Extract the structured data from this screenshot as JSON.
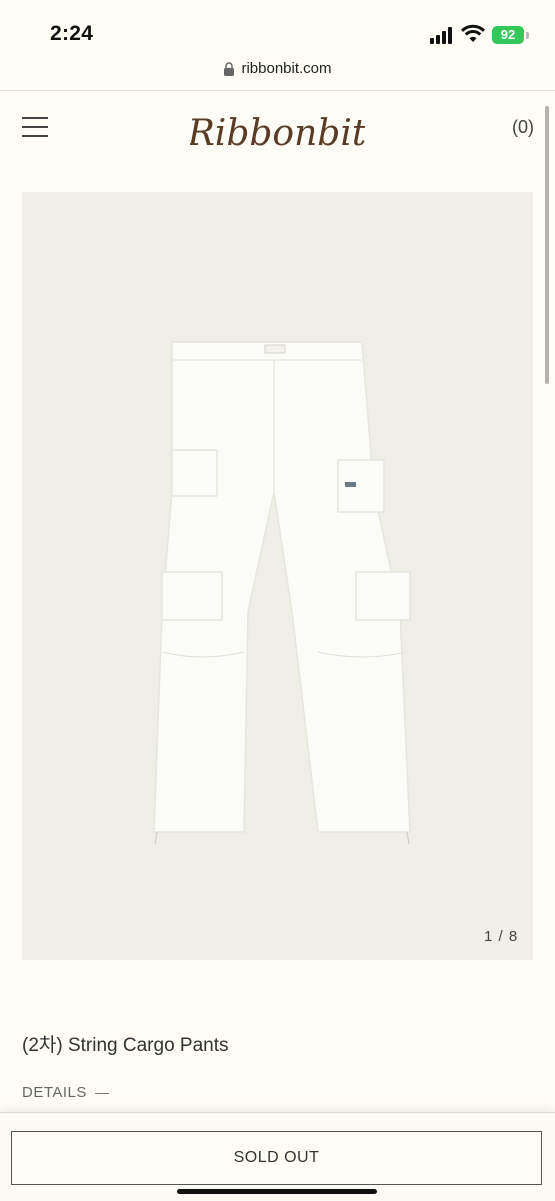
{
  "status_bar": {
    "time": "2:24",
    "battery": "92"
  },
  "browser": {
    "url": "ribbonbit.com"
  },
  "header": {
    "brand": "Ribbonbit",
    "cart_count": "(0)"
  },
  "gallery": {
    "counter": "1 / 8"
  },
  "product": {
    "title": "(2차) String Cargo Pants",
    "details_label": "DETAILS"
  },
  "actions": {
    "sold_out_label": "SOLD OUT"
  },
  "colors": {
    "background": "#fdfcf5",
    "gallery_bg": "#efeee7",
    "logo_brown": "#5a3b26",
    "battery_green": "#34c759"
  }
}
